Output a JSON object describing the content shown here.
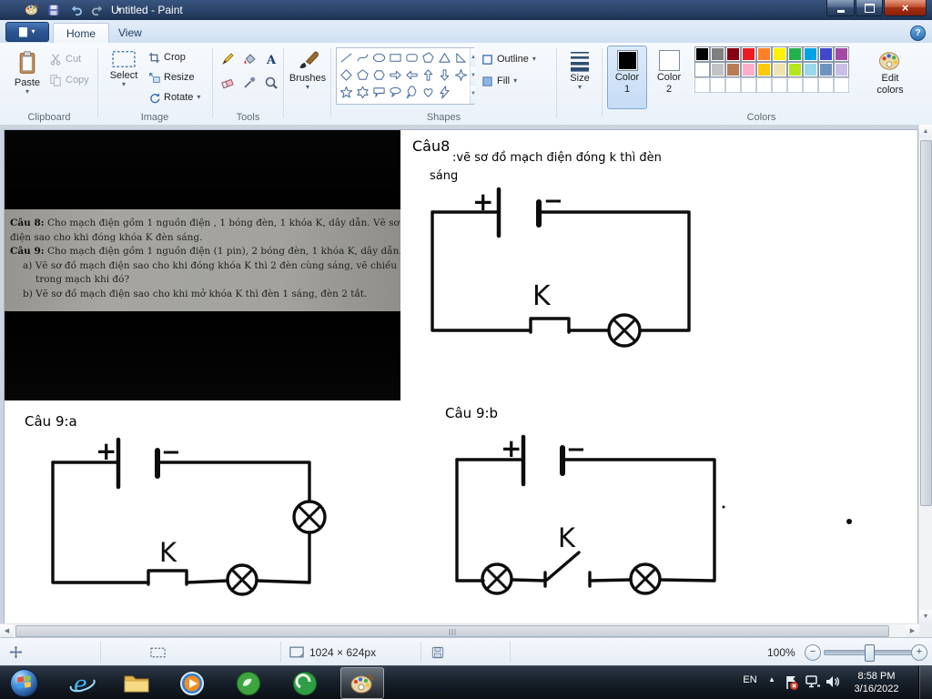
{
  "window": {
    "title": "Untitled - Paint"
  },
  "glyphs": {
    "dropdown": "▾",
    "up": "▲",
    "down": "▼",
    "left": "◀",
    "right": "▶",
    "close": "×",
    "help": "?",
    "minus": "−",
    "plus": "+",
    "hidden_icons": "▴"
  },
  "tabs": {
    "home": "Home",
    "view": "View"
  },
  "ribbon": {
    "group_labels": {
      "clipboard": "Clipboard",
      "image": "Image",
      "tools": "Tools",
      "shapes": "Shapes",
      "colors": "Colors"
    },
    "clipboard": {
      "paste": "Paste",
      "cut": "Cut",
      "copy": "Copy"
    },
    "image": {
      "select": "Select",
      "crop": "Crop",
      "resize": "Resize",
      "rotate": "Rotate"
    },
    "tools": {
      "icons": [
        "pencil",
        "fill-with-color",
        "text",
        "eraser",
        "color-picker",
        "magnifier"
      ]
    },
    "brushes": {
      "label": "Brushes"
    },
    "shapes_panel": {
      "outline": "Outline",
      "fill": "Fill",
      "items": [
        "line",
        "curve",
        "oval",
        "rectangle",
        "rounded-rectangle",
        "polygon",
        "triangle",
        "right-triangle",
        "diamond",
        "pentagon",
        "hexagon",
        "arrow-right",
        "arrow-left",
        "arrow-up",
        "arrow-down",
        "star-4",
        "star-5",
        "star-6",
        "callout-rectangle",
        "callout-oval",
        "callout-cloud",
        "heart",
        "lightning"
      ]
    },
    "size": {
      "label": "Size"
    },
    "colors": {
      "color1": {
        "line1": "Color",
        "line2": "1",
        "value": "#000000"
      },
      "color2": {
        "line1": "Color",
        "line2": "2",
        "value": "#ffffff"
      },
      "edit": {
        "line1": "Edit",
        "line2": "colors"
      },
      "palette": {
        "row1": [
          "#000000",
          "#7f7f7f",
          "#880015",
          "#ed1c24",
          "#ff7f27",
          "#fff200",
          "#22b14c",
          "#00a2e8",
          "#3f48cc",
          "#a349a4"
        ],
        "row2": [
          "#ffffff",
          "#c3c3c3",
          "#b97a57",
          "#ffaec9",
          "#ffc90e",
          "#efe4b0",
          "#b5e61d",
          "#99d9ea",
          "#7092be",
          "#c8bfe7"
        ],
        "row3": [
          null,
          null,
          null,
          null,
          null,
          null,
          null,
          null,
          null,
          null
        ]
      }
    }
  },
  "canvas": {
    "photo_lines": [
      {
        "strong": "Câu 8:",
        "rest": " Cho mạch điện gồm 1 nguồn điện , 1 bóng đèn, 1 khóa K, dây dẫn. Vẽ sơ đồ mạch",
        "indent": 0
      },
      {
        "strong": "",
        "rest": "điện sao cho khi đóng khóa K đèn sáng.",
        "indent": 0
      },
      {
        "strong": "Câu 9:",
        "rest": " Cho mạch điện gồm 1 nguồn điện (1 pin), 2 bóng đèn, 1 khóa K, dây dẫn.",
        "indent": 0
      },
      {
        "strong": "",
        "rest": "a)  Vẽ sơ đồ mạch điện sao cho khi đóng khóa K thì 2 đèn cùng sáng, vẽ chiều dòng điện",
        "indent": 1
      },
      {
        "strong": "",
        "rest": "trong mạch khi đó?",
        "indent": 2
      },
      {
        "strong": "",
        "rest": "b)  Vẽ sơ đồ mạch điện sao cho khi mở khóa K thì đèn 1 sáng, đèn 2 tắt.",
        "indent": 1
      }
    ],
    "cau8": {
      "title": "Câu8",
      "sub1": ":vẽ sơ đồ mạch điện đóng k thì đèn",
      "sub2": "sáng",
      "plus": "+",
      "minus": "−",
      "k": "K"
    },
    "cau9a": {
      "title": "Câu 9:a",
      "plus": "+",
      "minus": "−",
      "k": "K"
    },
    "cau9b": {
      "title": "Câu 9:b",
      "plus": "+",
      "minus": "−",
      "k": "K"
    }
  },
  "statusbar": {
    "canvas_size": "1024 × 624px",
    "zoom": "100%"
  },
  "taskbar": {
    "language": "EN",
    "time": "8:58 PM",
    "date": "3/16/2022"
  }
}
